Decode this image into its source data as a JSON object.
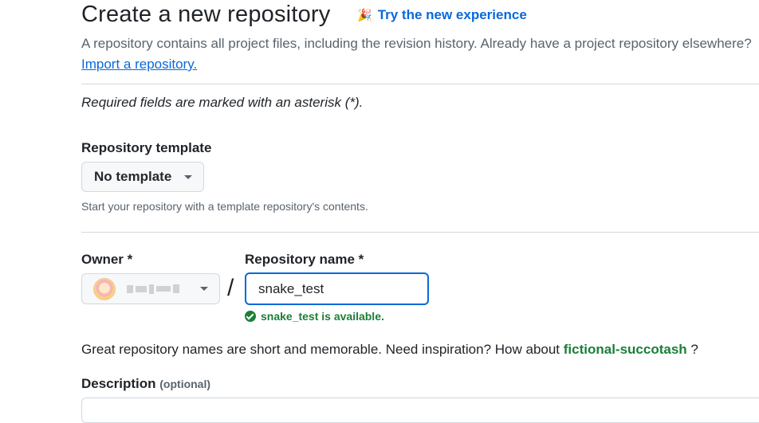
{
  "header": {
    "title": "Create a new repository",
    "try_new_label": "Try the new experience",
    "lead_text": "A repository contains all project files, including the revision history. Already have a project repository elsewhere?",
    "import_link": "Import a repository",
    "import_suffix": "."
  },
  "form": {
    "required_note": "Required fields are marked with an asterisk (*).",
    "template": {
      "label": "Repository template",
      "selected": "No template",
      "hint": "Start your repository with a template repository's contents."
    },
    "owner": {
      "label": "Owner *"
    },
    "separator": "/",
    "repo_name": {
      "label": "Repository name *",
      "value": "snake_test",
      "availability": "snake_test is available."
    },
    "suggestion": {
      "prefix": "Great repository names are short and memorable. Need inspiration? How about ",
      "name": "fictional-succotash",
      "suffix": " ?"
    },
    "description": {
      "label": "Description",
      "optional": "(optional)"
    }
  },
  "colors": {
    "link": "#0969da",
    "success": "#1a7f37",
    "muted": "#59636e",
    "border": "#d1d9e0"
  },
  "icons": [
    "party-popper-icon",
    "chevron-down-icon",
    "check-circle-icon"
  ]
}
